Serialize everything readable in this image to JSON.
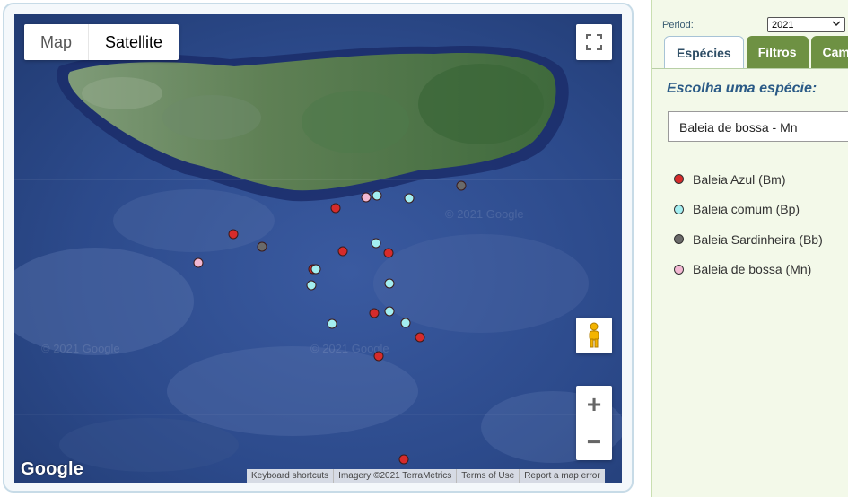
{
  "map": {
    "type_control": {
      "map_label": "Map",
      "satellite_label": "Satellite",
      "selected": "Satellite"
    },
    "google_logo": "Google",
    "attribution": [
      "Keyboard shortcuts",
      "Imagery ©2021 TerraMetrics",
      "Terms of Use",
      "Report a map error"
    ],
    "watermarks": [
      "© 2021 Google",
      "© 2021 Google",
      "© 2021 Google"
    ],
    "icons": {
      "fullscreen": "fullscreen-icon",
      "pegman": "pegman-icon",
      "zoom_in": "plus-icon",
      "zoom_out": "minus-icon"
    },
    "zoom_in_label": "+",
    "zoom_out_label": "−"
  },
  "colors": {
    "Bm": "#d62b2b",
    "Bp": "#a3eef0",
    "Bb": "#6a6a6a",
    "Mn": "#f2b8d2",
    "tab_active_text": "#2f4e66",
    "tab_inactive_bg": "#6e9143",
    "title": "#2a5a86"
  },
  "panel": {
    "period_label": "Period:",
    "period_value": "2021",
    "tabs": [
      {
        "label": "Espécies",
        "active": true
      },
      {
        "label": "Filtros",
        "active": false
      },
      {
        "label": "Cam",
        "active": false
      }
    ],
    "choose_title": "Escolha uma espécie:",
    "species_selected": "Baleia de bossa - Mn",
    "legend": [
      {
        "label": "Baleia Azul (Bm)",
        "code": "Bm"
      },
      {
        "label": "Baleia comum (Bp)",
        "code": "Bp"
      },
      {
        "label": "Baleia Sardinheira (Bb)",
        "code": "Bb"
      },
      {
        "label": "Baleia de bossa (Mn)",
        "code": "Mn"
      }
    ]
  }
}
